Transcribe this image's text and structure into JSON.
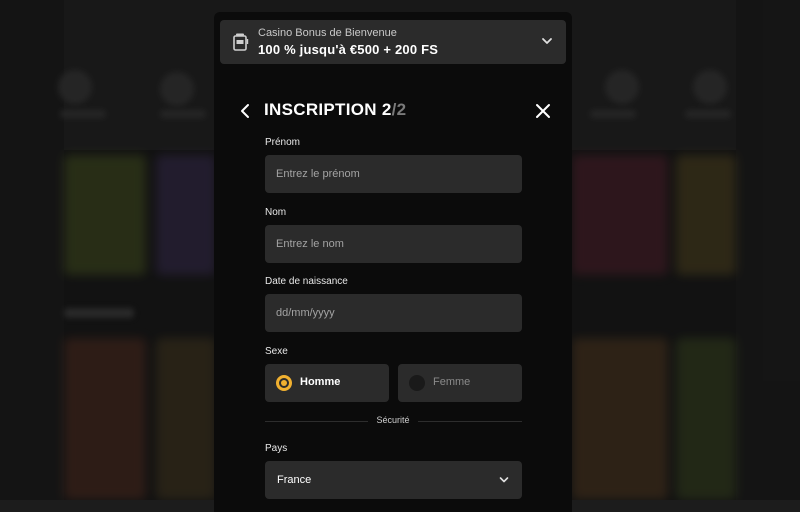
{
  "bonus": {
    "subtitle": "Casino Bonus de Bienvenue",
    "offer": "100 % jusqu'à €500 + 200 FS",
    "icon": "slot-machine-icon",
    "toggle_icon": "chevron-down-icon"
  },
  "header": {
    "title": "INSCRIPTION 2",
    "step_separator": "/2",
    "back_icon": "arrow-left-icon",
    "close_icon": "close-icon"
  },
  "form": {
    "first_name": {
      "label": "Prénom",
      "placeholder": "Entrez le prénom",
      "value": ""
    },
    "last_name": {
      "label": "Nom",
      "placeholder": "Entrez le nom",
      "value": ""
    },
    "birth_date": {
      "label": "Date de naissance",
      "placeholder": "dd/mm/yyyy",
      "value": ""
    },
    "gender": {
      "label": "Sexe",
      "options": [
        {
          "label": "Homme",
          "selected": true
        },
        {
          "label": "Femme",
          "selected": false
        }
      ]
    },
    "security_section": "Sécurité",
    "country": {
      "label": "Pays",
      "value": "France"
    }
  },
  "colors": {
    "accent": "#f0b030",
    "modal_bg": "#0b0b0b",
    "field_bg": "#2b2b2b"
  }
}
